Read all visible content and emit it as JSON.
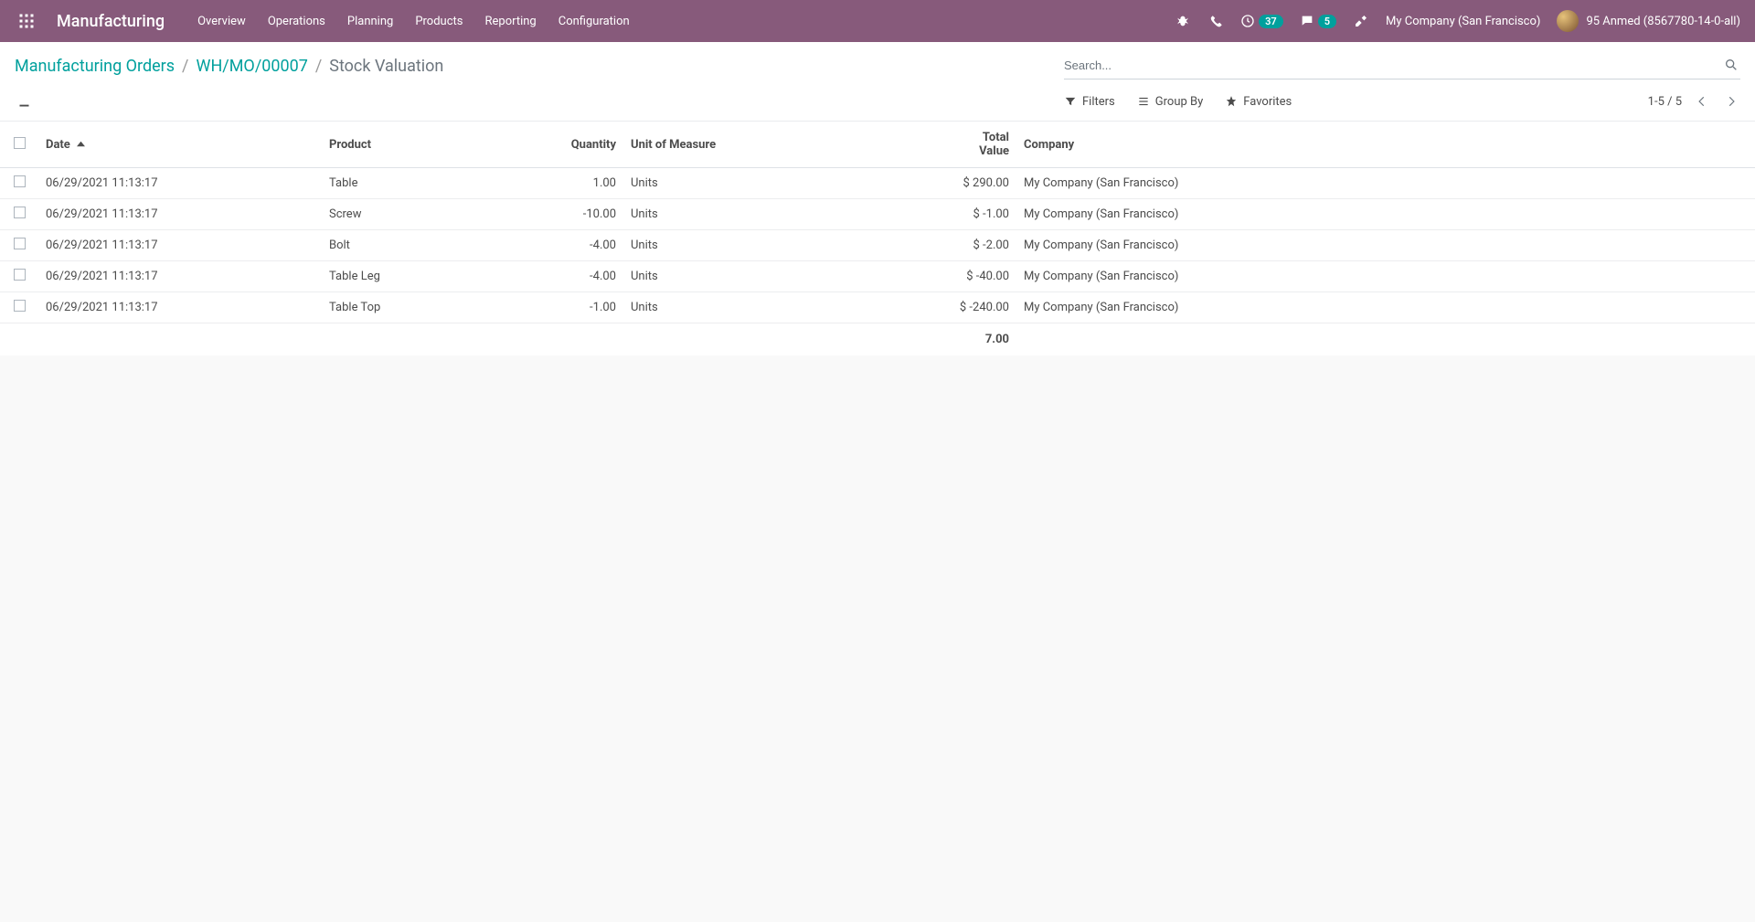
{
  "nav": {
    "app": "Manufacturing",
    "menu": [
      "Overview",
      "Operations",
      "Planning",
      "Products",
      "Reporting",
      "Configuration"
    ],
    "activities_badge": "37",
    "messages_badge": "5",
    "company": "My Company (San Francisco)",
    "user": "95 Anmed (8567780-14-0-all)"
  },
  "breadcrumb": {
    "root": "Manufacturing Orders",
    "parent": "WH/MO/00007",
    "current": "Stock Valuation"
  },
  "search": {
    "placeholder": "Search..."
  },
  "controls": {
    "filters": "Filters",
    "groupby": "Group By",
    "favorites": "Favorites",
    "pager": "1-5 / 5"
  },
  "table": {
    "headers": {
      "date": "Date",
      "product": "Product",
      "quantity": "Quantity",
      "uom": "Unit of Measure",
      "total": "Total Value",
      "company": "Company"
    },
    "rows": [
      {
        "date": "06/29/2021 11:13:17",
        "product": "Table",
        "quantity": "1.00",
        "uom": "Units",
        "total": "$ 290.00",
        "company": "My Company (San Francisco)"
      },
      {
        "date": "06/29/2021 11:13:17",
        "product": "Screw",
        "quantity": "-10.00",
        "uom": "Units",
        "total": "$ -1.00",
        "company": "My Company (San Francisco)"
      },
      {
        "date": "06/29/2021 11:13:17",
        "product": "Bolt",
        "quantity": "-4.00",
        "uom": "Units",
        "total": "$ -2.00",
        "company": "My Company (San Francisco)"
      },
      {
        "date": "06/29/2021 11:13:17",
        "product": "Table Leg",
        "quantity": "-4.00",
        "uom": "Units",
        "total": "$ -40.00",
        "company": "My Company (San Francisco)"
      },
      {
        "date": "06/29/2021 11:13:17",
        "product": "Table Top",
        "quantity": "-1.00",
        "uom": "Units",
        "total": "$ -240.00",
        "company": "My Company (San Francisco)"
      }
    ],
    "footer_total": "7.00"
  }
}
